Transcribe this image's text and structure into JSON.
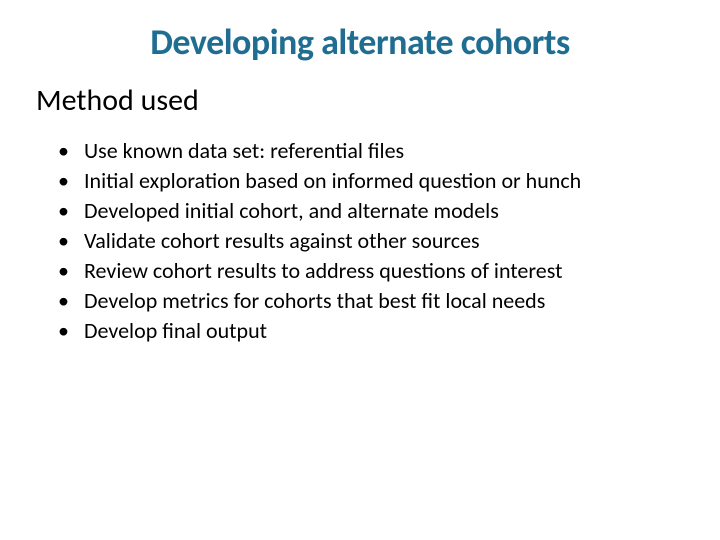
{
  "title": "Developing alternate cohorts",
  "subheading": "Method used",
  "bullets": [
    "Use known data set: referential files",
    "Initial exploration based on informed question or hunch",
    "Developed initial cohort, and alternate models",
    "Validate cohort results against other sources",
    "Review cohort results to address questions of interest",
    "Develop metrics for cohorts that best fit local needs",
    "Develop final output"
  ]
}
